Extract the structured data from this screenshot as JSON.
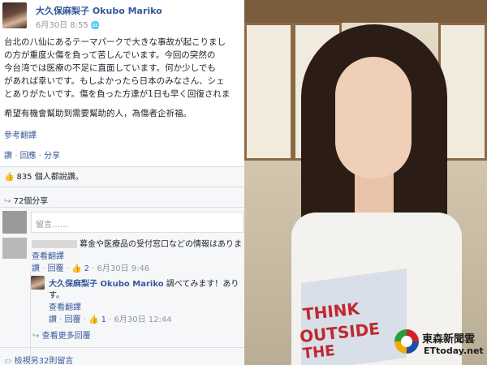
{
  "post": {
    "author": "大久保麻梨子 Okubo Mariko",
    "time": "6月30日 8:55",
    "globe_icon": "globe-icon",
    "lines": [
      "台北の八仙にあるテーマパークで大きな事故が起こりまし",
      "の方が重度火傷を負って苦しんでいます。今回の突然の",
      "今台湾では医療の不足に直面しています。何か少しでも",
      "があれば幸いです。もしよかったら日本のみなさん、シェ",
      "とありがたいです。傷を負った方達が1日も早く回復されま"
    ],
    "zh_line": "希望有機會幫助到需要幫助的人，為傷者企祈福。",
    "see_translation": "參考翻譯",
    "actions": [
      "讚",
      "回應",
      "分享"
    ],
    "likes": "835 個人都說讚。",
    "shares": "72個分享"
  },
  "comment_box": {
    "placeholder": "留言……"
  },
  "comment1": {
    "text": "募金や医療品の受付窓口などの情報はありま",
    "see_translation": "查看翻譯",
    "actions": [
      "讚",
      "回覆"
    ],
    "like_count": "2",
    "time": "6月30日 9:46"
  },
  "reply": {
    "author": "大久保麻梨子 Okubo Mariko",
    "text": "調べてみます！あり",
    "text2": "す。",
    "see_translation": "查看翻譯",
    "actions": [
      "讚",
      "回覆"
    ],
    "like_count": "1",
    "time": "6月30日 12:44"
  },
  "more_replies": "查看更多回覆",
  "more_comments": "檢視另32則留言",
  "photo": {
    "shirt_text": [
      "THINK",
      "OUTSIDE",
      "THE"
    ],
    "watermark_zh": "東森新聞雲",
    "watermark_en": "ETtoday.net"
  },
  "colors": {
    "link": "#365899",
    "muted": "#90949c",
    "like_blue": "#4267b2",
    "shirt_red": "#c0282e"
  }
}
